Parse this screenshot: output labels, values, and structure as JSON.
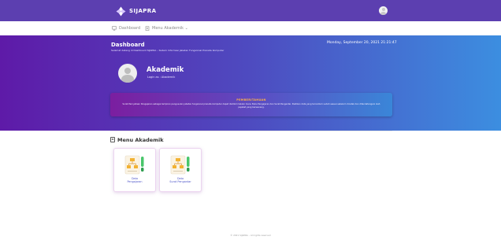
{
  "app": {
    "name": "SIJAPRA"
  },
  "subnav": {
    "items": [
      {
        "label": "Dashboard"
      },
      {
        "label": "Menu Akademik ⌄"
      }
    ]
  },
  "header": {
    "title": "Dashboard",
    "subtitle": "Selamat datang di Dashboard SIJAPRA – Sistem Informasi Jabatan Fungsional Pranata Komputer",
    "datetime": "Monday, September 20, 2021 21:21:47"
  },
  "profile": {
    "name": "Akademik",
    "role": "Login as : Akademik"
  },
  "notice": {
    "title": "PEMBERITAHUAN",
    "body": "Surat Pernyataan Pengajaran sebagai lampiran pengusulan jabatan fungsional pranata komputer dapat diambil melalui menu Buku Pengajaran dan Surat Pengantar. Pastikan data yang tercantum sudah sesuai sebelum dicetak dan ditandatangani oleh pejabat yang berwenang."
  },
  "section": {
    "title": "Menu Akademik"
  },
  "menu": [
    {
      "label_line1": "Data",
      "label_line2": "Pengajaran"
    },
    {
      "label_line1": "Data",
      "label_line2": "Surat Pengantar"
    }
  ],
  "footer": {
    "text": "© 2021 SIJAPRA – All rights reserved"
  },
  "colors": {
    "nav": "#5c3fb0",
    "hero_start": "#5e1aa8",
    "hero_end": "#3c8ee0",
    "notice_title": "#ffb347",
    "menu_label": "#4f56c9"
  },
  "icons": {
    "brand": "puzzle-logo-icon",
    "dashboard": "monitor-icon",
    "menu": "clipboard-icon",
    "section": "book-icon",
    "card": "org-chart-document-icon"
  }
}
